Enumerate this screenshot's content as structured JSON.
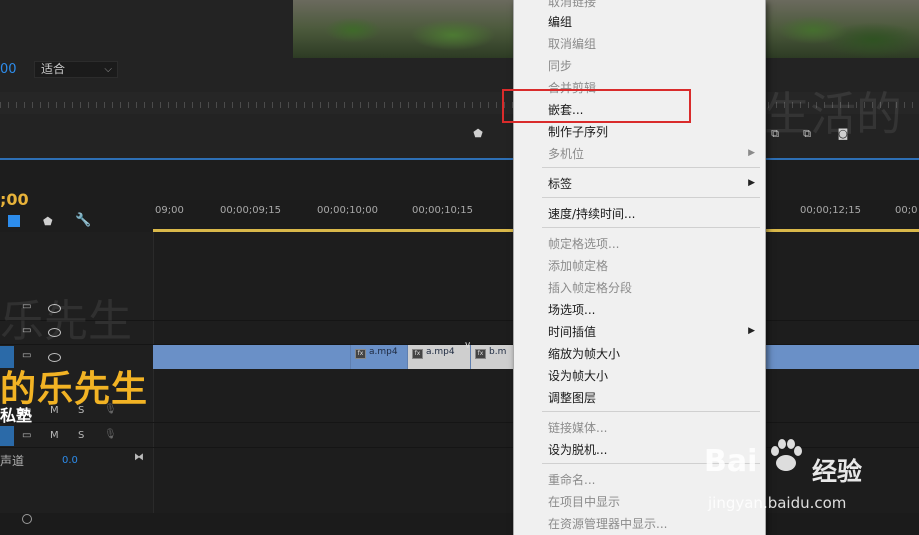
{
  "monitor": {
    "timecode_fragment": "00",
    "fit_select": {
      "value": "适合"
    }
  },
  "watermark": {
    "top_right": "生活的",
    "left_mid": "乐先生"
  },
  "timeline": {
    "timecode_fragment": ";00",
    "ruler_labels": [
      "09;00",
      "00;00;09;15",
      "00;00;10;00",
      "00;00;10;15",
      "00;00;12;15",
      "00;0"
    ],
    "clips": [
      {
        "name": "a.mp4"
      },
      {
        "name": "a.mp4"
      },
      {
        "name": "b.m"
      }
    ],
    "track_m": "M",
    "track_s": "S",
    "audio_channel_label": "声道",
    "audio_value": "0.0",
    "overlay_title": "的乐先生",
    "overlay_subtitle": "私塾"
  },
  "context_menu": {
    "items": [
      {
        "label": "取消链接",
        "enabled": false
      },
      {
        "label": "编组",
        "enabled": true
      },
      {
        "label": "取消编组",
        "enabled": false
      },
      {
        "label": "同步",
        "enabled": false
      },
      {
        "label": "合并剪辑",
        "enabled": false
      },
      {
        "label": "嵌套...",
        "enabled": true
      },
      {
        "label": "制作子序列",
        "enabled": true
      },
      {
        "label": "多机位",
        "enabled": false
      },
      {
        "label": "标签",
        "enabled": true
      },
      {
        "label": "速度/持续时间...",
        "enabled": true
      },
      {
        "label": "帧定格选项...",
        "enabled": false
      },
      {
        "label": "添加帧定格",
        "enabled": false
      },
      {
        "label": "插入帧定格分段",
        "enabled": false
      },
      {
        "label": "场选项...",
        "enabled": true
      },
      {
        "label": "时间插值",
        "enabled": true
      },
      {
        "label": "缩放为帧大小",
        "enabled": true
      },
      {
        "label": "设为帧大小",
        "enabled": true
      },
      {
        "label": "调整图层",
        "enabled": true
      },
      {
        "label": "链接媒体...",
        "enabled": false
      },
      {
        "label": "设为脱机...",
        "enabled": true
      },
      {
        "label": "重命名...",
        "enabled": false
      },
      {
        "label": "在项目中显示",
        "enabled": false
      },
      {
        "label": "在资源管理器中显示...",
        "enabled": false
      }
    ]
  },
  "baidu": {
    "logo": "Bai",
    "jingyan": "经验",
    "url": "jingyan.baidu.com"
  },
  "colors": {
    "accent_blue": "#2d8ceb",
    "timecode_yellow": "#e8b33a",
    "highlight_red": "#d92b2b",
    "clip_track": "#6a90c7"
  }
}
